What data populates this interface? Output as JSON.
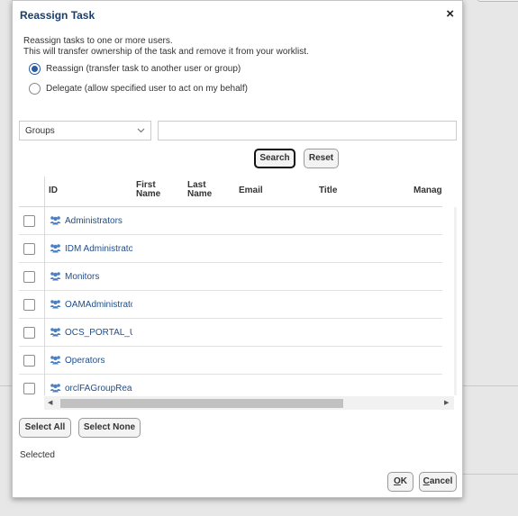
{
  "dialog": {
    "title": "Reassign Task",
    "close_glyph": "×",
    "description_line1": "Reassign tasks to one or more users.",
    "description_line2": "This will transfer ownership of the task and remove it from your worklist."
  },
  "options": {
    "reassign_label": "Reassign (transfer task to another user or group)",
    "delegate_label": "Delegate (allow specified user to act on my behalf)",
    "selected": "reassign"
  },
  "search": {
    "type_value": "Groups",
    "query_value": "",
    "search_label": "Search",
    "reset_label": "Reset"
  },
  "table": {
    "headers": {
      "id": "ID",
      "first_name_1": "First",
      "first_name_2": "Name",
      "last_name_1": "Last",
      "last_name_2": "Name",
      "email": "Email",
      "title": "Title",
      "manager": "Manag"
    },
    "rows": [
      {
        "id": "Administrators"
      },
      {
        "id": "IDM Administrator"
      },
      {
        "id": "Monitors"
      },
      {
        "id": "OAMAdministrator"
      },
      {
        "id": "OCS_PORTAL_U"
      },
      {
        "id": "Operators"
      },
      {
        "id": "orclFAGroupReac"
      }
    ]
  },
  "selection_buttons": {
    "select_all": "Select All",
    "select_none": "Select None"
  },
  "selected_label": "Selected",
  "footer": {
    "ok_mnemonic": "O",
    "ok_rest": "K",
    "cancel_mnemonic": "C",
    "cancel_rest": "ancel"
  },
  "colors": {
    "title": "#1a3d6b",
    "link": "#1f4e8c",
    "radio_accent": "#2b5c9b",
    "group_icon": "#4a7fc1"
  },
  "icons": {
    "group": "group-icon",
    "close": "close-icon",
    "chevron": "chevron-down-icon"
  }
}
